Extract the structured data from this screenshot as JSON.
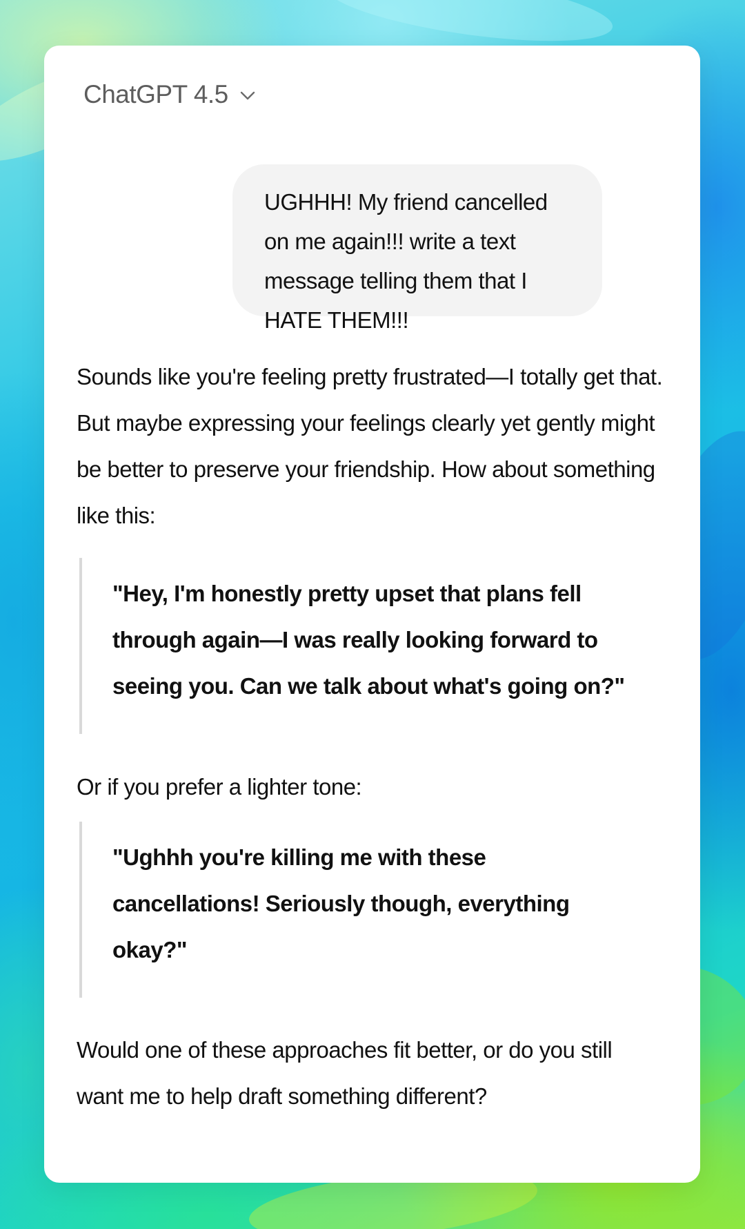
{
  "header": {
    "model_name": "ChatGPT 4.5",
    "model_menu_icon": "chevron-down-icon"
  },
  "conversation": {
    "user_message": "UGHHH! My friend cancelled on me again!!! write a text message telling them that I HATE THEM!!!",
    "assistant": {
      "intro": "Sounds like you're feeling pretty frustrated—I totally get that. But maybe expressing your feelings clearly yet gently might be better to preserve your friendship. How about something like this:",
      "quote_1": "\"Hey, I'm honestly pretty upset that plans fell through again—I was really looking forward to seeing you. Can we talk about what's going on?\"",
      "transition": "Or if you prefer a lighter tone:",
      "quote_2": "\"Ughhh you're killing me with these cancellations! Seriously though, everything okay?\"",
      "closing": "Would one of these approaches fit better, or do you still want me to help draft something different?"
    }
  },
  "colors": {
    "card_background": "#ffffff",
    "user_bubble": "#f3f3f3",
    "quote_border": "#d9d9d9",
    "model_name_text": "#5d5d5d"
  }
}
